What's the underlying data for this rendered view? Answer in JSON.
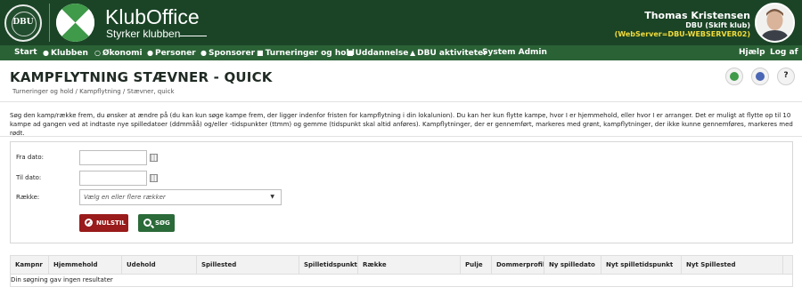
{
  "header": {
    "seal_text": "DBU",
    "app_name": "KlubOffice",
    "tagline": "Styrker klubben",
    "user": {
      "name": "Thomas Kristensen",
      "club": "DBU (Skift klub)",
      "server": "(WebServer=DBU-WEBSERVER02)"
    }
  },
  "nav": {
    "items": [
      {
        "label": "Start",
        "icon": ""
      },
      {
        "label": "Klubben",
        "icon": "group-icon"
      },
      {
        "label": "Økonomi",
        "icon": "coin-icon"
      },
      {
        "label": "Personer",
        "icon": "person-icon"
      },
      {
        "label": "Sponsorer",
        "icon": "sponsor-icon"
      },
      {
        "label": "Turneringer og hold",
        "icon": "trophy-icon"
      },
      {
        "label": "Uddannelse",
        "icon": "book-icon"
      },
      {
        "label": "DBU aktiviteter",
        "icon": "graduation-icon"
      },
      {
        "label": "System Admin",
        "icon": ""
      }
    ],
    "right": {
      "help": "Hjælp",
      "logout": "Log af"
    }
  },
  "page": {
    "title": "KAMPFLYTNING STÆVNER - QUICK",
    "breadcrumb": "Turneringer og hold / Kampflytning / Stævner, quick",
    "info": "Søg den kamp/række frem, du ønsker at ændre på (du kan kun søge kampe frem, der ligger indenfor fristen for kampflytning i din lokalunion). Du kan her kun flytte kampe, hvor I er hjemmehold, eller hvor I er arranger. Det er muligt at flytte op til 10 kampe ad gangen ved at indtaste nye spilledatoer (ddmmåå) og/eller -tidspunkter (ttmm) og gemme (tidspunkt skal altid anføres). Kampflytninger, der er gennemført, markeres med grønt, kampflytninger, der ikke kunne gennemføres, markeres med rødt."
  },
  "form": {
    "from_label": "Fra dato:",
    "from_value": "",
    "to_label": "Til dato:",
    "to_value": "",
    "series_label": "Række:",
    "series_placeholder": "Vælg en eller flere rækker",
    "reset_label": "NULSTIL",
    "search_label": "SØG"
  },
  "table": {
    "columns": [
      "Kampnr",
      "Hjemmehold",
      "Udehold",
      "Spillested",
      "Spilletidspunkt",
      "Række",
      "Pulje",
      "Dommerprofil",
      "Ny spilledato",
      "Nyt spilletidspunkt",
      "Nyt Spillested"
    ],
    "empty_message": "Din søgning gav ingen resultater"
  },
  "colors": {
    "header_bg": "#1b4426",
    "nav_bg": "#2a6236",
    "server_text": "#f2dc3a",
    "reset_button": "#9a1b1b",
    "search_button": "#2b6a39"
  }
}
